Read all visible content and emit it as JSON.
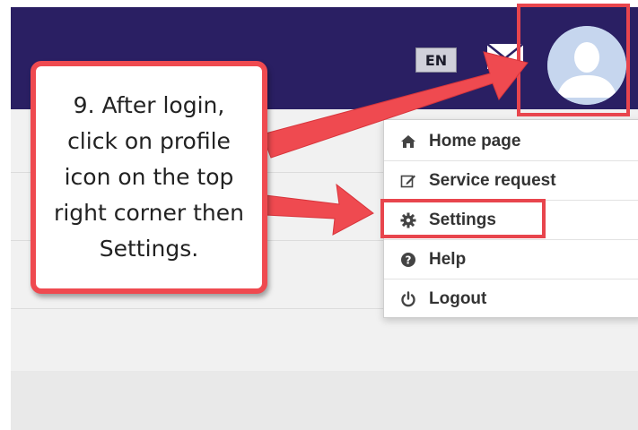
{
  "header": {
    "language": "EN",
    "icons": [
      "mail-icon",
      "user-avatar-icon"
    ]
  },
  "menu": {
    "items": [
      {
        "label": "Home page",
        "icon": "home-icon"
      },
      {
        "label": "Service request",
        "icon": "edit-icon"
      },
      {
        "label": "Settings",
        "icon": "gear-icon"
      },
      {
        "label": "Help",
        "icon": "question-circle-icon"
      },
      {
        "label": "Logout",
        "icon": "power-icon"
      }
    ]
  },
  "callout": {
    "text": "9. After login, click on profile icon on the top right corner then Settings."
  },
  "colors": {
    "navbar": "#2a1f63",
    "highlight": "#e8454d",
    "avatar_bg": "#c6d6ee",
    "avatar_fg": "#ffffff"
  }
}
